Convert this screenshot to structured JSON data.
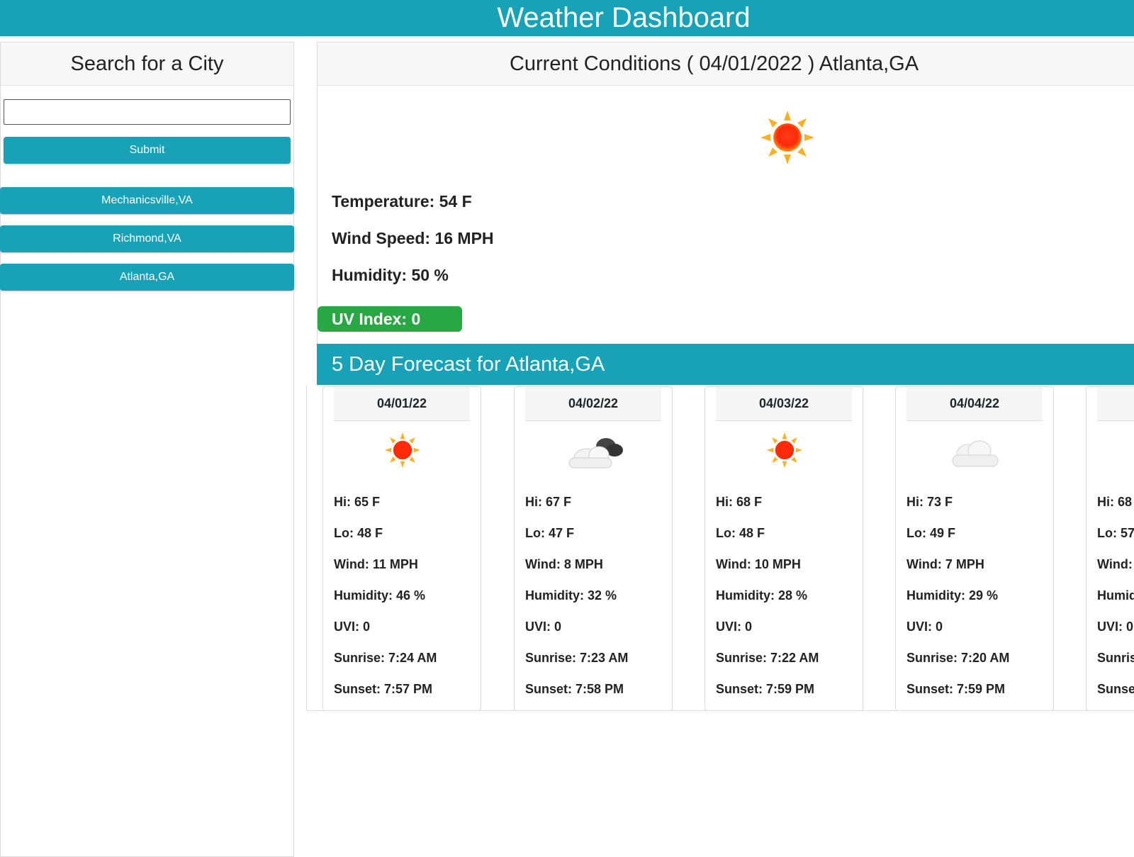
{
  "header": {
    "title": "Weather Dashboard"
  },
  "sidebar": {
    "title": "Search for a City",
    "search_value": "",
    "submit_label": "Submit",
    "history": [
      "Mechanicsville,VA",
      "Richmond,VA",
      "Atlanta,GA"
    ]
  },
  "current": {
    "title": "Current Conditions ( 04/01/2022 ) Atlanta,GA",
    "icon": "sun-icon",
    "temperature": "Temperature: 54 F",
    "wind": "Wind Speed: 16 MPH",
    "humidity": "Humidity: 50 %",
    "uv": "UV Index: 0",
    "uv_color": "#28a745"
  },
  "forecast": {
    "title": "5 Day Forecast for Atlanta,GA",
    "days": [
      {
        "date": "04/01/22",
        "icon": "sun-icon",
        "hi": "Hi: 65 F",
        "lo": "Lo: 48 F",
        "wind": "Wind: 11 MPH",
        "humidity": "Humidity: 46 %",
        "uvi": "UVI: 0",
        "sunrise": "Sunrise: 7:24 AM",
        "sunset": "Sunset: 7:57 PM"
      },
      {
        "date": "04/02/22",
        "icon": "cloud-icon",
        "hi": "Hi: 67 F",
        "lo": "Lo: 47 F",
        "wind": "Wind: 8 MPH",
        "humidity": "Humidity: 32 %",
        "uvi": "UVI: 0",
        "sunrise": "Sunrise: 7:23 AM",
        "sunset": "Sunset: 7:58 PM"
      },
      {
        "date": "04/03/22",
        "icon": "sun-icon",
        "hi": "Hi: 68 F",
        "lo": "Lo: 48 F",
        "wind": "Wind: 10 MPH",
        "humidity": "Humidity: 28 %",
        "uvi": "UVI: 0",
        "sunrise": "Sunrise: 7:22 AM",
        "sunset": "Sunset: 7:59 PM"
      },
      {
        "date": "04/04/22",
        "icon": "cloud-icon",
        "hi": "Hi: 73 F",
        "lo": "Lo: 49 F",
        "wind": "Wind: 7 MPH",
        "humidity": "Humidity: 29 %",
        "uvi": "UVI: 0",
        "sunrise": "Sunrise: 7:20 AM",
        "sunset": "Sunset: 7:59 PM"
      },
      {
        "date": "",
        "icon": "",
        "hi": "Hi: 68",
        "lo": "Lo: 57",
        "wind": "Wind:",
        "humidity": "Humid",
        "uvi": "UVI: 0",
        "sunrise": "Sunris",
        "sunset": "Sunset"
      }
    ]
  },
  "colors": {
    "accent": "#17a2b8",
    "uv_ok": "#28a745"
  }
}
